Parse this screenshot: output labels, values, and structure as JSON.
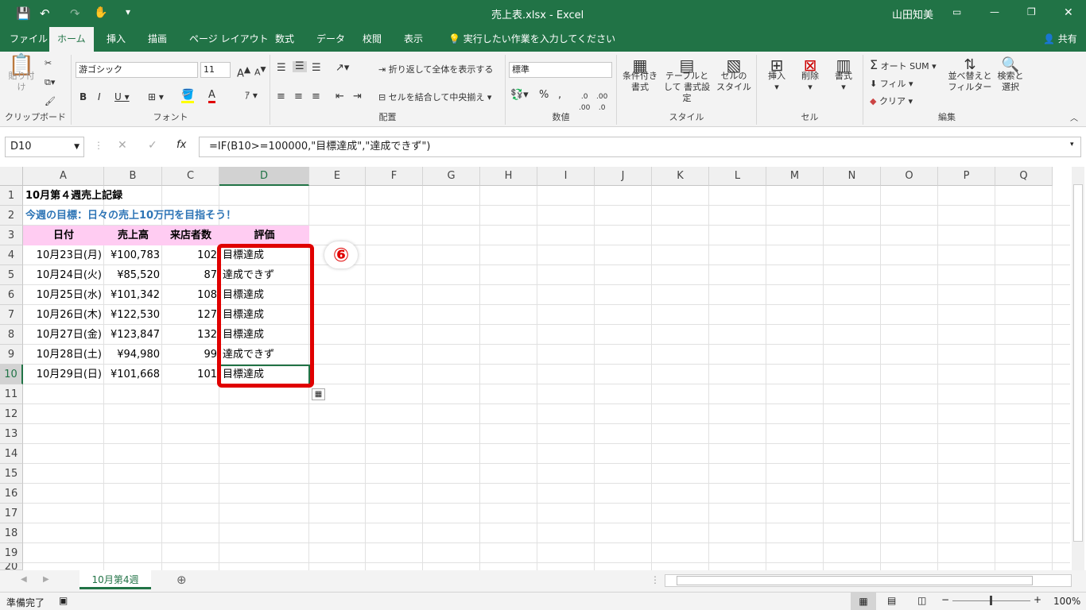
{
  "window": {
    "title": "売上表.xlsx - Excel",
    "user": "山田知美",
    "share": "共有"
  },
  "tabs": [
    "ファイル",
    "ホーム",
    "挿入",
    "描画",
    "ページ レイアウト",
    "数式",
    "データ",
    "校閲",
    "表示"
  ],
  "tell_me": "実行したい作業を入力してください",
  "ribbon": {
    "paste": "貼り付け",
    "clipboard": "クリップボード",
    "font_name": "游ゴシック",
    "font_size": "11",
    "font_group": "フォント",
    "wrap": "折り返して全体を表示する",
    "merge": "セルを結合して中央揃え",
    "align_group": "配置",
    "num_format": "標準",
    "num_group": "数値",
    "cond": "条件付き 書式",
    "table": "テーブルとして 書式設定",
    "cellstyle": "セルの スタイル",
    "style_group": "スタイル",
    "insert": "挿入",
    "delete": "削除",
    "format": "書式",
    "cell_group": "セル",
    "autosum": "オート SUM",
    "fill": "フィル",
    "clear": "クリア",
    "sort": "並べ替えと フィルター",
    "find": "検索と 選択",
    "edit_group": "編集"
  },
  "formula": {
    "namebox": "D10",
    "content": "=IF(B10>=100000,\"目標達成\",\"達成できず\")"
  },
  "columns": [
    "A",
    "B",
    "C",
    "D",
    "E",
    "F",
    "G",
    "H",
    "I",
    "J",
    "K",
    "L",
    "M",
    "N",
    "O",
    "P",
    "Q"
  ],
  "rows": [
    "1",
    "2",
    "3",
    "4",
    "5",
    "6",
    "7",
    "8",
    "9",
    "10",
    "11",
    "12",
    "13",
    "14",
    "15",
    "16",
    "17",
    "18",
    "19",
    "20"
  ],
  "sheet": {
    "title": "10月第４週売上記録",
    "goal": "今週の目標：日々の売上10万円を目指そう！",
    "headers": [
      "日付",
      "売上高",
      "来店者数",
      "評価"
    ],
    "data": [
      [
        "10月23日(月)",
        "¥100,783",
        "102",
        "目標達成"
      ],
      [
        "10月24日(火)",
        "¥85,520",
        "87",
        "達成できず"
      ],
      [
        "10月25日(水)",
        "¥101,342",
        "108",
        "目標達成"
      ],
      [
        "10月26日(木)",
        "¥122,530",
        "127",
        "目標達成"
      ],
      [
        "10月27日(金)",
        "¥123,847",
        "132",
        "目標達成"
      ],
      [
        "10月28日(土)",
        "¥94,980",
        "99",
        "達成できず"
      ],
      [
        "10月29日(日)",
        "¥101,668",
        "101",
        "目標達成"
      ]
    ]
  },
  "callout": "⑥",
  "sheet_tab": "10月第4週",
  "status": {
    "ready": "準備完了",
    "zoom": "100%"
  },
  "colors": {
    "accent": "#217346",
    "header_fill": "#ffccf2",
    "goal_text": "#2e75b6",
    "highlight": "#e00000"
  }
}
